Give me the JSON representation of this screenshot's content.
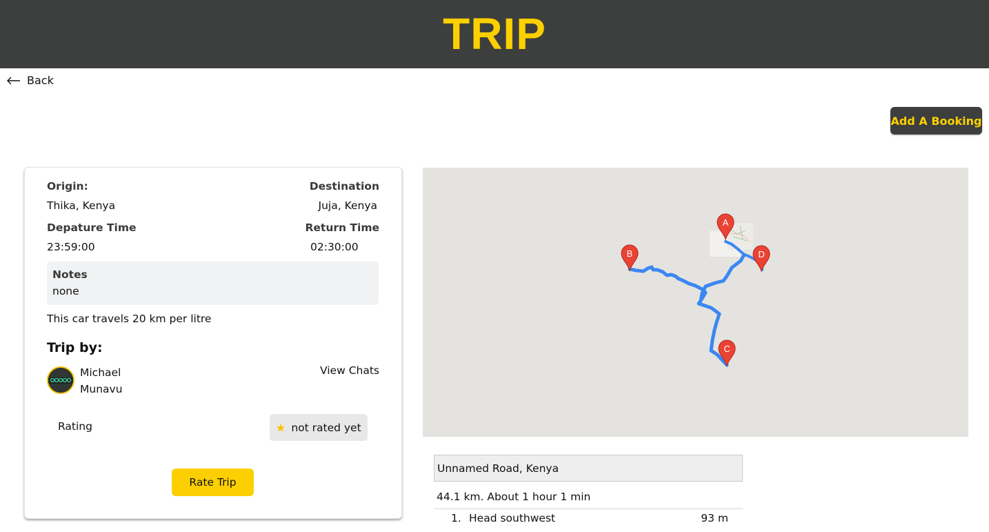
{
  "header": {
    "title": "TRIP"
  },
  "nav": {
    "back_label": "Back"
  },
  "actions": {
    "add_booking_label": "Add A Booking"
  },
  "trip": {
    "origin_label": "Origin:",
    "origin_value": "Thika, Kenya",
    "destination_label": "Destination",
    "destination_value": "Juja, Kenya",
    "departure_label": "Depature Time",
    "departure_value": "23:59:00",
    "return_label": "Return Time",
    "return_value": "02:30:00",
    "notes_label": "Notes",
    "notes_value": "none",
    "fuel_text": "This car travels 20 km per litre",
    "trip_by_label": "Trip by:",
    "driver_name": "Michael Munavu",
    "view_chats_label": "View Chats",
    "rating_label": "Rating",
    "rating_value": "not rated yet",
    "rate_button_label": "Rate Trip"
  },
  "map": {
    "markers": [
      "A",
      "B",
      "C",
      "D"
    ],
    "marker_color": "#ea4335",
    "route_color": "#4285f4"
  },
  "directions": {
    "start_address": "Unnamed Road, Kenya",
    "summary": "44.1 km. About 1 hour 1 min",
    "steps": [
      {
        "number": "1.",
        "instruction": "Head southwest",
        "distance": "93 m"
      }
    ]
  },
  "colors": {
    "header_bg": "#3d3f3e",
    "accent": "#fcd000"
  }
}
